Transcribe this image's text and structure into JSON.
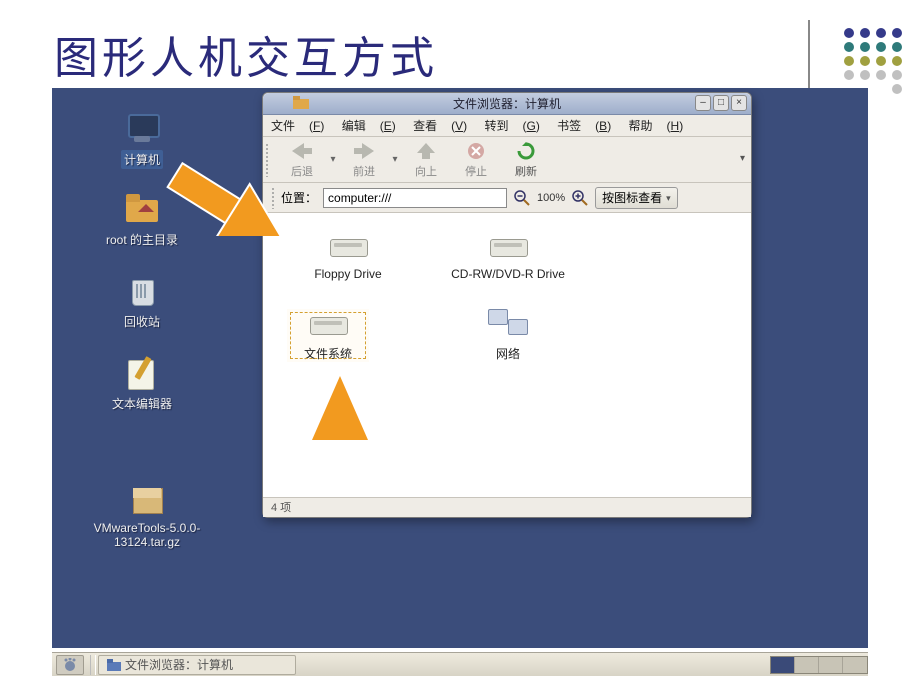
{
  "slide": {
    "title": "图形人机交互方式"
  },
  "desktop_icons": {
    "computer": "计算机",
    "home": "root 的主目录",
    "trash": "回收站",
    "editor": "文本编辑器",
    "package": "VMwareTools-5.0.0-13124.tar.gz"
  },
  "fm": {
    "title": "文件浏览器：计算机",
    "menu": {
      "file": "文件",
      "file_u": "F",
      "edit": "编辑",
      "edit_u": "E",
      "view": "查看",
      "view_u": "V",
      "go": "转到",
      "go_u": "G",
      "bookmarks": "书签",
      "bookmarks_u": "B",
      "help": "帮助",
      "help_u": "H"
    },
    "toolbar": {
      "back": "后退",
      "forward": "前进",
      "up": "向上",
      "stop": "停止",
      "reload": "刷新"
    },
    "location_label": "位置：",
    "location_value": "computer:///",
    "zoom_label": "100%",
    "view_mode": "按图标查看",
    "items": {
      "floppy": "Floppy Drive",
      "cdrom": "CD-RW/DVD-R Drive",
      "filesystem": "文件系统",
      "network": "网络"
    },
    "status": "4 项",
    "winbtn": {
      "min": "–",
      "max": "□",
      "close": "×"
    }
  },
  "taskbar": {
    "task_label": "文件浏览器：计算机"
  }
}
